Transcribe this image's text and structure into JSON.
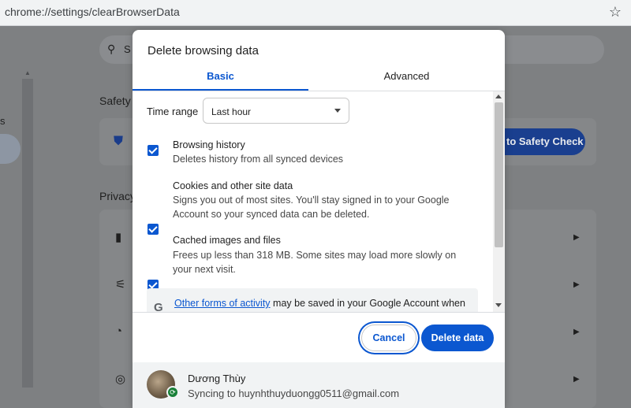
{
  "browser": {
    "url": "chrome://settings/clearBrowserData",
    "bookmark_icon": "star-icon"
  },
  "background": {
    "search_placeholder": "S",
    "left_nav_text": "s",
    "safety_heading": "Safety",
    "safety_check_button": "to Safety Check",
    "privacy_heading": "Privacy",
    "row_icons": [
      "trash-icon",
      "cookie-settings-icon",
      "cookie-icon",
      "ads-privacy-icon"
    ]
  },
  "dialog": {
    "title": "Delete browsing data",
    "tabs": [
      {
        "label": "Basic",
        "active": true
      },
      {
        "label": "Advanced",
        "active": false
      }
    ],
    "time_range": {
      "label": "Time range",
      "value": "Last hour"
    },
    "options": [
      {
        "title": "Browsing history",
        "description": "Deletes history from all synced devices",
        "checked": true
      },
      {
        "title": "Cookies and other site data",
        "description": "Signs you out of most sites. You'll stay signed in to your Google Account so your synced data can be deleted.",
        "checked": true
      },
      {
        "title": "Cached images and files",
        "description": "Frees up less than 318 MB. Some sites may load more slowly on your next visit.",
        "checked": true
      }
    ],
    "info": {
      "icon": "G",
      "link_text": "Other forms of activity",
      "rest_text": " may be saved in your Google Account when"
    },
    "buttons": {
      "cancel": "Cancel",
      "delete": "Delete data"
    },
    "account": {
      "name": "Dương Thùy",
      "status": "Syncing to huynhthuyduongg0511@gmail.com"
    }
  },
  "colors": {
    "accent": "#0b57d0",
    "sync_badge": "#188038"
  }
}
